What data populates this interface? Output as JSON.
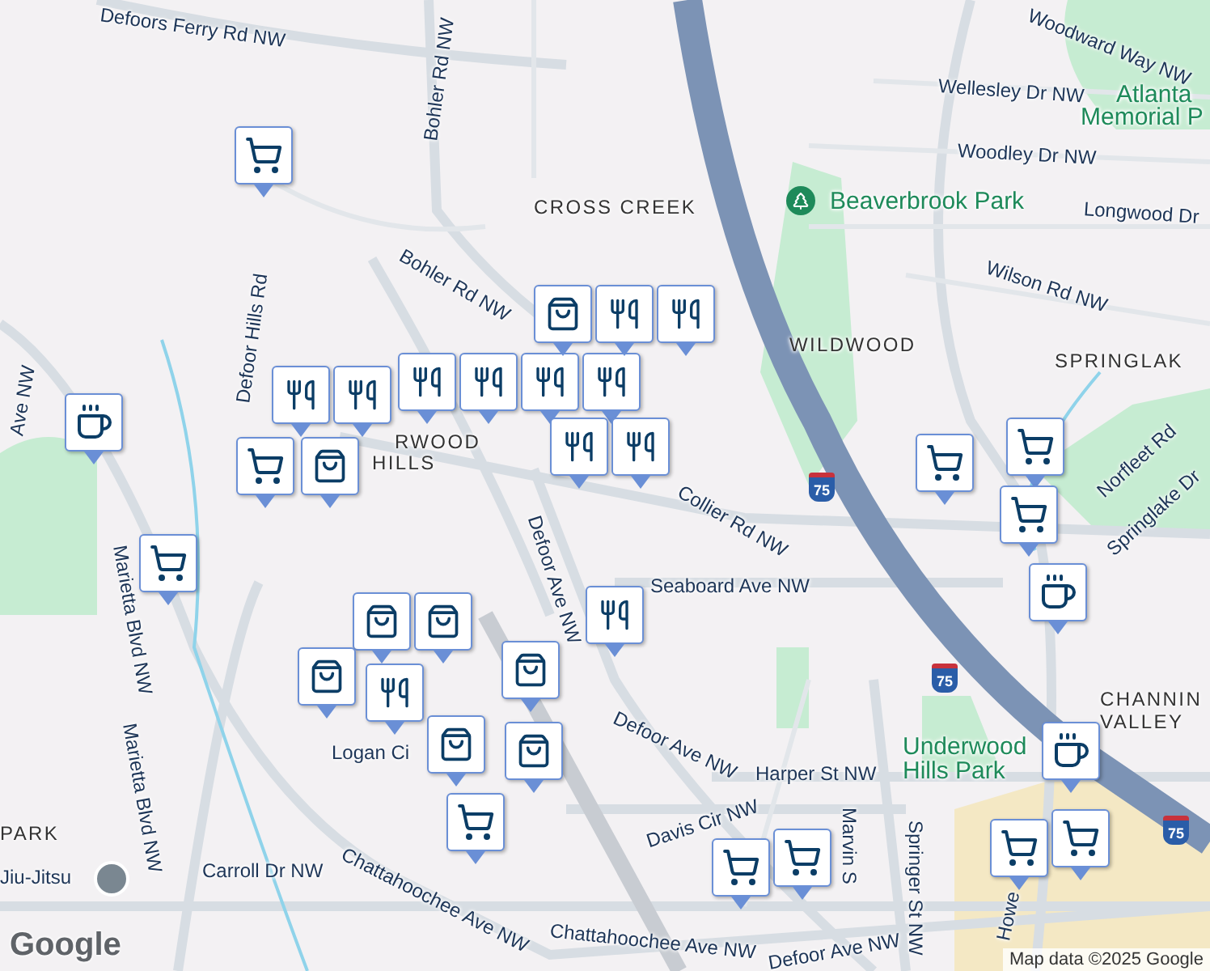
{
  "map": {
    "labels": [
      {
        "text": "Defoors Ferry Rd NW",
        "kind": "road"
      },
      {
        "text": "Bohler Rd NW",
        "kind": "road"
      },
      {
        "text": "CROSS CREEK",
        "kind": "area"
      },
      {
        "text": "Beaverbrook Park",
        "kind": "park"
      },
      {
        "text": "Wellesley Dr NW",
        "kind": "road"
      },
      {
        "text": "Atlanta",
        "kind": "park"
      },
      {
        "text": "Memorial P",
        "kind": "park"
      },
      {
        "text": "Woodward Way NW",
        "kind": "road"
      },
      {
        "text": "Woodley Dr NW",
        "kind": "road"
      },
      {
        "text": "Longwood Dr",
        "kind": "road"
      },
      {
        "text": "Wilson Rd NW",
        "kind": "road"
      },
      {
        "text": "WILDWOOD",
        "kind": "area"
      },
      {
        "text": "SPRINGLAK",
        "kind": "area"
      },
      {
        "text": "Bohler Rd NW",
        "kind": "road"
      },
      {
        "text": "Defoor Hills Rd",
        "kind": "road"
      },
      {
        "text": "RWOOD",
        "kind": "area"
      },
      {
        "text": "HILLS",
        "kind": "area"
      },
      {
        "text": "Ave NW",
        "kind": "road"
      },
      {
        "text": "Collier Rd NW",
        "kind": "road"
      },
      {
        "text": "Defoor Ave NW",
        "kind": "road"
      },
      {
        "text": "Seaboard Ave NW",
        "kind": "road"
      },
      {
        "text": "Norfleet Rd",
        "kind": "road"
      },
      {
        "text": "Springlake Dr",
        "kind": "road"
      },
      {
        "text": "CHANNIN",
        "kind": "area"
      },
      {
        "text": "VALLEY",
        "kind": "area"
      },
      {
        "text": "Underwood",
        "kind": "park"
      },
      {
        "text": "Hills Park",
        "kind": "park"
      },
      {
        "text": "Marietta Blvd NW",
        "kind": "road"
      },
      {
        "text": "Marietta Blvd NW",
        "kind": "road"
      },
      {
        "text": "Logan Ci",
        "kind": "road"
      },
      {
        "text": "Defoor Ave NW",
        "kind": "road"
      },
      {
        "text": "Harper St NW",
        "kind": "road"
      },
      {
        "text": "Marvin S",
        "kind": "road"
      },
      {
        "text": "Davis Cir NW",
        "kind": "road"
      },
      {
        "text": "Springer St NW",
        "kind": "road"
      },
      {
        "text": "Howe",
        "kind": "road"
      },
      {
        "text": "PARK",
        "kind": "area"
      },
      {
        "text": "Jiu-Jitsu",
        "kind": "poi"
      },
      {
        "text": "Carroll Dr NW",
        "kind": "road"
      },
      {
        "text": "Chattahoochee Ave NW",
        "kind": "road"
      },
      {
        "text": "Chattahoochee Ave NW",
        "kind": "road"
      },
      {
        "text": "Defoor Ave NW",
        "kind": "road"
      }
    ],
    "shields": [
      "75",
      "75",
      "75"
    ],
    "markers": [
      {
        "kind": "cart"
      },
      {
        "kind": "cup"
      },
      {
        "kind": "cart"
      },
      {
        "kind": "cart"
      },
      {
        "kind": "bag"
      },
      {
        "kind": "fork"
      },
      {
        "kind": "fork"
      },
      {
        "kind": "fork"
      },
      {
        "kind": "fork"
      },
      {
        "kind": "fork"
      },
      {
        "kind": "fork"
      },
      {
        "kind": "bag"
      },
      {
        "kind": "fork"
      },
      {
        "kind": "fork"
      },
      {
        "kind": "fork"
      },
      {
        "kind": "fork"
      },
      {
        "kind": "bag"
      },
      {
        "kind": "bag"
      },
      {
        "kind": "fork"
      },
      {
        "kind": "bag"
      },
      {
        "kind": "fork"
      },
      {
        "kind": "bag"
      },
      {
        "kind": "bag"
      },
      {
        "kind": "bag"
      },
      {
        "kind": "cart"
      },
      {
        "kind": "cart"
      },
      {
        "kind": "cart"
      },
      {
        "kind": "cart"
      },
      {
        "kind": "cup"
      },
      {
        "kind": "cup"
      },
      {
        "kind": "cart"
      },
      {
        "kind": "cart"
      },
      {
        "kind": "cart"
      },
      {
        "kind": "cart"
      }
    ],
    "logo": "Google",
    "attribution": "Map data ©2025 Google"
  }
}
